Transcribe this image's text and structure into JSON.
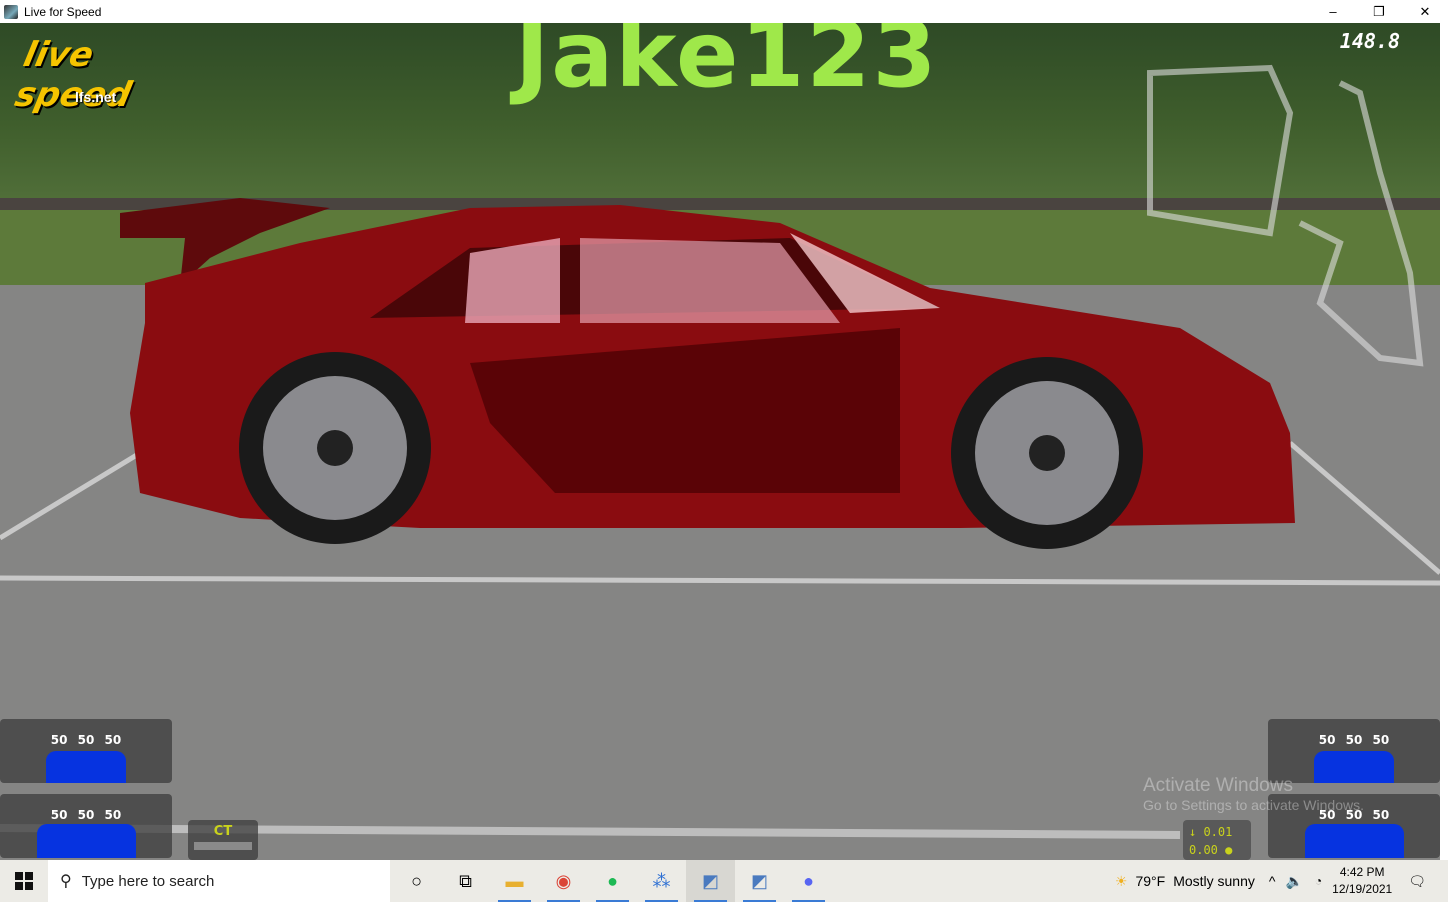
{
  "window": {
    "title": "Live for Speed",
    "minimize": "–",
    "restore": "❐",
    "close": "✕"
  },
  "hud": {
    "player_name": "Jake123",
    "speed": "148.8",
    "logo_text": "live for speed",
    "logo_url": "lfs.net",
    "tyres": {
      "front_left": "50 50 50",
      "rear_left": "50 50 50",
      "front_right": "50 50 50",
      "rear_right": "50 50 50"
    },
    "ct_label": "CT",
    "delta_top": "↓ 0.01",
    "delta_bottom": "0.00 ●",
    "tyre_color": "#0633e0",
    "hud_accent": "#9fe84a"
  },
  "watermark": {
    "line1": "Activate Windows",
    "line2": "Go to Settings to activate Windows."
  },
  "taskbar": {
    "search_placeholder": "Type here to search",
    "weather_temp": "79°F",
    "weather_desc": "Mostly sunny",
    "time": "4:42 PM",
    "date": "12/19/2021",
    "apps": [
      "cortana",
      "task-view",
      "file-explorer",
      "chrome",
      "spotify",
      "network-app",
      "live-for-speed",
      "live-for-speed-2",
      "discord"
    ]
  }
}
